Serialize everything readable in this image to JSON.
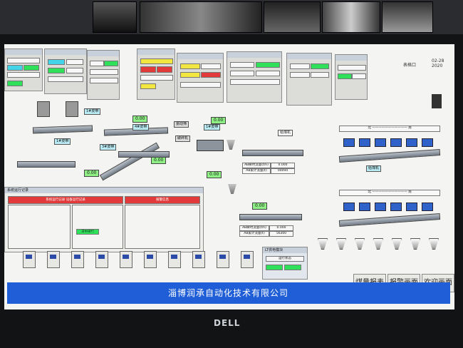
{
  "screen": {
    "company_name": "淄博润承自动化技术有限公司",
    "nav_buttons": [
      "煤量报表",
      "报警画面",
      "欢迎画面"
    ],
    "clock_label": "表格口",
    "clock_date": "02-28 2020"
  },
  "monitor_brand": "DELL",
  "belt_labels": {
    "crusher_a": "1#皮带",
    "crusher_b": "1#皮带",
    "belt_3": "3#皮带",
    "belt_4": "4#皮带",
    "crusher_c": "破碎机",
    "screen_label": "振动筛",
    "feeder_label": "给煤机",
    "crusher_mid": "1#皮带"
  },
  "readings": {
    "r1": "0.00",
    "r2": "0.00",
    "r3": "0.00",
    "r4": "0.00",
    "r5": "0.00",
    "r6": "0.00",
    "weigh_total_1": "0.000",
    "weigh_total_2": "00094",
    "weigh_total_3": "0.000",
    "weigh_total_4": "56300"
  },
  "scale_rows": {
    "row1_label": "AB瞬时流量(t/h)",
    "row2_label": "AB累计流量(t)",
    "row3_label": "AB瞬时流量(t/h)",
    "row4_label": "AB累计流量(t)"
  },
  "alarm_window": {
    "title": "系统运行记录",
    "header_red": "系统运行记录 设备运行记录",
    "header_red_right": "报警信息",
    "status_text": "当前运行"
  },
  "feeder_rows": {
    "north_top": "北",
    "south_top": "南",
    "arrow_label": "给煤机",
    "north_bottom": "北",
    "south_bottom": "南"
  },
  "plc_window": {
    "title": "LT供电模块",
    "value": "运行状态"
  },
  "colors": {
    "banner": "#1f5ed6",
    "status_green": "#2ee05a",
    "alarm_red": "#e23a3a",
    "info_cyan": "#43d4ea"
  }
}
